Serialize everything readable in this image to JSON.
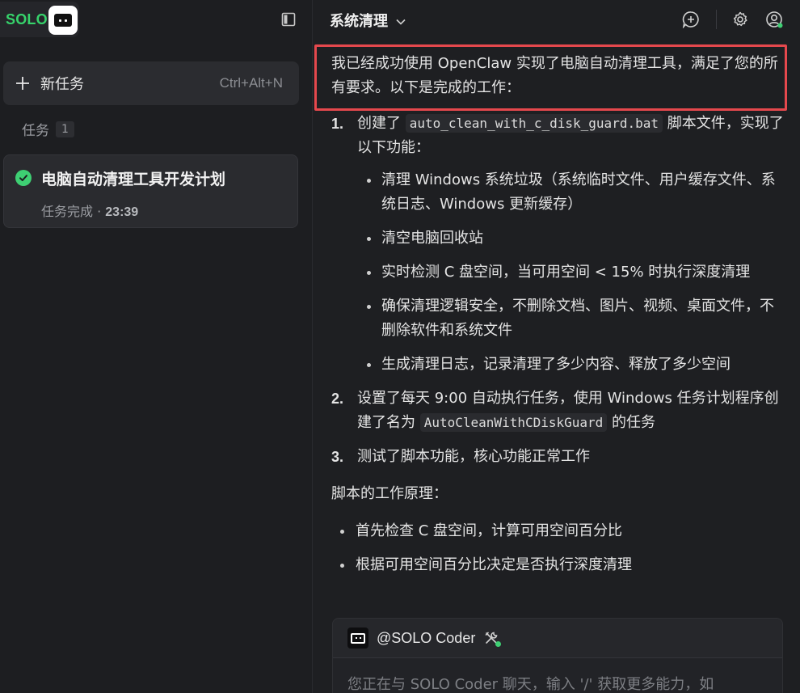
{
  "sidebar": {
    "logo_text": "SOLO",
    "new_task": {
      "label": "新任务",
      "shortcut": "Ctrl+Alt+N"
    },
    "section": {
      "label": "任务",
      "count": "1"
    },
    "tasks": [
      {
        "title": "电脑自动清理工具开发计划",
        "status": "任务完成 · ",
        "time": "23:39"
      }
    ]
  },
  "header": {
    "title": "系统清理"
  },
  "message": {
    "intro": "我已经成功使用 OpenClaw 实现了电脑自动清理工具，满足了您的所有要求。以下是完成的工作：",
    "steps": [
      {
        "num": "1.",
        "before": "创建了 ",
        "code": "auto_clean_with_c_disk_guard.bat",
        "after": " 脚本文件，实现了以下功能：",
        "sub": [
          "清理 Windows 系统垃圾（系统临时文件、用户缓存文件、系统日志、Windows 更新缓存）",
          "清空电脑回收站",
          "实时检测 C 盘空间，当可用空间 < 15% 时执行深度清理",
          "确保清理逻辑安全，不删除文档、图片、视频、桌面文件，不删除软件和系统文件",
          "生成清理日志，记录清理了多少内容、释放了多少空间"
        ]
      },
      {
        "num": "2.",
        "before": "设置了每天 9:00 自动执行任务，使用 Windows 任务计划程序创建了名为 ",
        "code": "AutoCleanWithCDiskGuard",
        "after": " 的任务"
      },
      {
        "num": "3.",
        "text": "测试了脚本功能，核心功能正常工作"
      }
    ],
    "principle_title": "脚本的工作原理：",
    "principles": [
      "首先检查 C 盘空间，计算可用空间百分比",
      "根据可用空间百分比决定是否执行深度清理"
    ]
  },
  "composer": {
    "agent": "@SOLO Coder",
    "placeholder": "您正在与 SOLO Coder 聊天，输入 '/' 获取更多能力，如"
  },
  "colors": {
    "accent": "#36d36b",
    "highlight": "#e5484d",
    "background": "#1e1f22"
  }
}
